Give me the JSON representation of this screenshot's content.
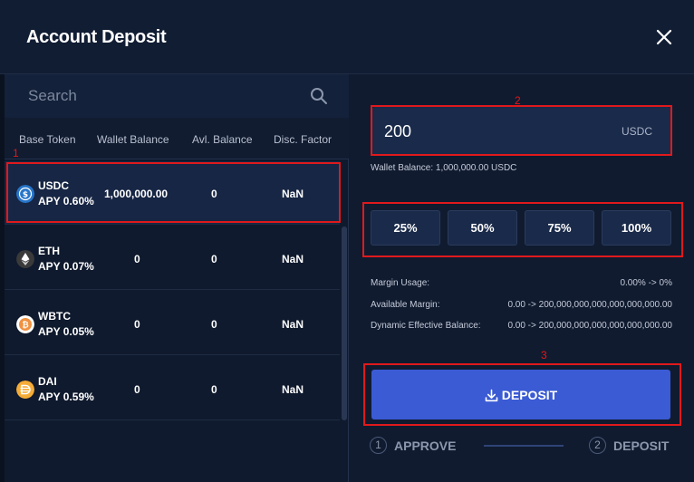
{
  "modal": {
    "title": "Account Deposit"
  },
  "search": {
    "placeholder": "Search"
  },
  "table": {
    "headers": [
      "Base Token",
      "Wallet Balance",
      "Avl. Balance",
      "Disc. Factor"
    ],
    "rows": [
      {
        "token": "USDC",
        "apy": "APY  0.60%",
        "wallet_balance": "1,000,000.00",
        "avl_balance": "0",
        "disc_factor": "NaN",
        "icon": "usdc-icon",
        "icon_color": "#2775ca"
      },
      {
        "token": "ETH",
        "apy": "APY  0.07%",
        "wallet_balance": "0",
        "avl_balance": "0",
        "disc_factor": "NaN",
        "icon": "eth-icon",
        "icon_color": "#3a3a3a"
      },
      {
        "token": "WBTC",
        "apy": "APY  0.05%",
        "wallet_balance": "0",
        "avl_balance": "0",
        "disc_factor": "NaN",
        "icon": "wbtc-icon",
        "icon_color": "#f09242"
      },
      {
        "token": "DAI",
        "apy": "APY  0.59%",
        "wallet_balance": "0",
        "avl_balance": "0",
        "disc_factor": "NaN",
        "icon": "dai-icon",
        "icon_color": "#f5ac37"
      }
    ]
  },
  "deposit_form": {
    "amount_value": "200",
    "amount_unit": "USDC",
    "wallet_balance": "Wallet Balance: 1,000,000.00 USDC",
    "percent_buttons": [
      "25%",
      "50%",
      "75%",
      "100%"
    ],
    "info": [
      {
        "label": "Margin Usage:",
        "value": "0.00% -> 0%"
      },
      {
        "label": "Available Margin:",
        "value": "0.00  -> 200,000,000,000,000,000,000.00"
      },
      {
        "label": "Dynamic Effective Balance:",
        "value": "0.00 -> 200,000,000,000,000,000,000.00"
      }
    ],
    "deposit_label": "DEPOSIT"
  },
  "steps": [
    {
      "num": "1",
      "label": "APPROVE"
    },
    {
      "num": "2",
      "label": "DEPOSIT"
    }
  ],
  "annotations": [
    "1",
    "2",
    "3"
  ],
  "colors": {
    "accent": "#3b5bd4",
    "annotation": "#e0191c",
    "background": "#0f1a2e"
  }
}
